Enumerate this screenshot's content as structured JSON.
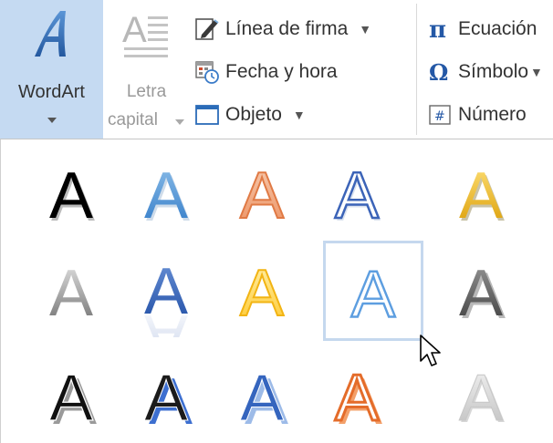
{
  "ribbon": {
    "wordart": {
      "label": "WordArt",
      "icon": "wordart-icon"
    },
    "letra_capital": {
      "line1": "Letra",
      "line2": "capital",
      "icon": "drop-cap-icon"
    },
    "linea_de_firma": {
      "label": "Línea de firma",
      "icon": "signature-line-icon"
    },
    "fecha_y_hora": {
      "label": "Fecha y hora",
      "icon": "date-time-icon"
    },
    "objeto": {
      "label": "Objeto",
      "icon": "object-icon"
    },
    "ecuacion": {
      "label": "Ecuación",
      "icon": "pi-icon"
    },
    "simbolo": {
      "label": "Símbolo",
      "icon": "omega-icon"
    },
    "numero": {
      "label": "Número",
      "icon": "number-icon"
    }
  },
  "gallery": {
    "glyph": "A",
    "styles": [
      "black-shadow",
      "blue-gradient",
      "orange-outline",
      "blue-outline-white",
      "gold-fill",
      "gray-gradient",
      "blue-reflection",
      "gold-outline",
      "light-blue-outline",
      "dark-gray-bevel",
      "black-shadow-outline",
      "black-blue-shadow",
      "blue-blue-shadow",
      "orange-white-outline",
      "silver-light"
    ],
    "selected_index": 8
  },
  "colors": {
    "selected_button_bg": "#c5daf2",
    "hover_outline": "#c5d8ee",
    "wordart_icon_blue": "#2f6fbf"
  }
}
